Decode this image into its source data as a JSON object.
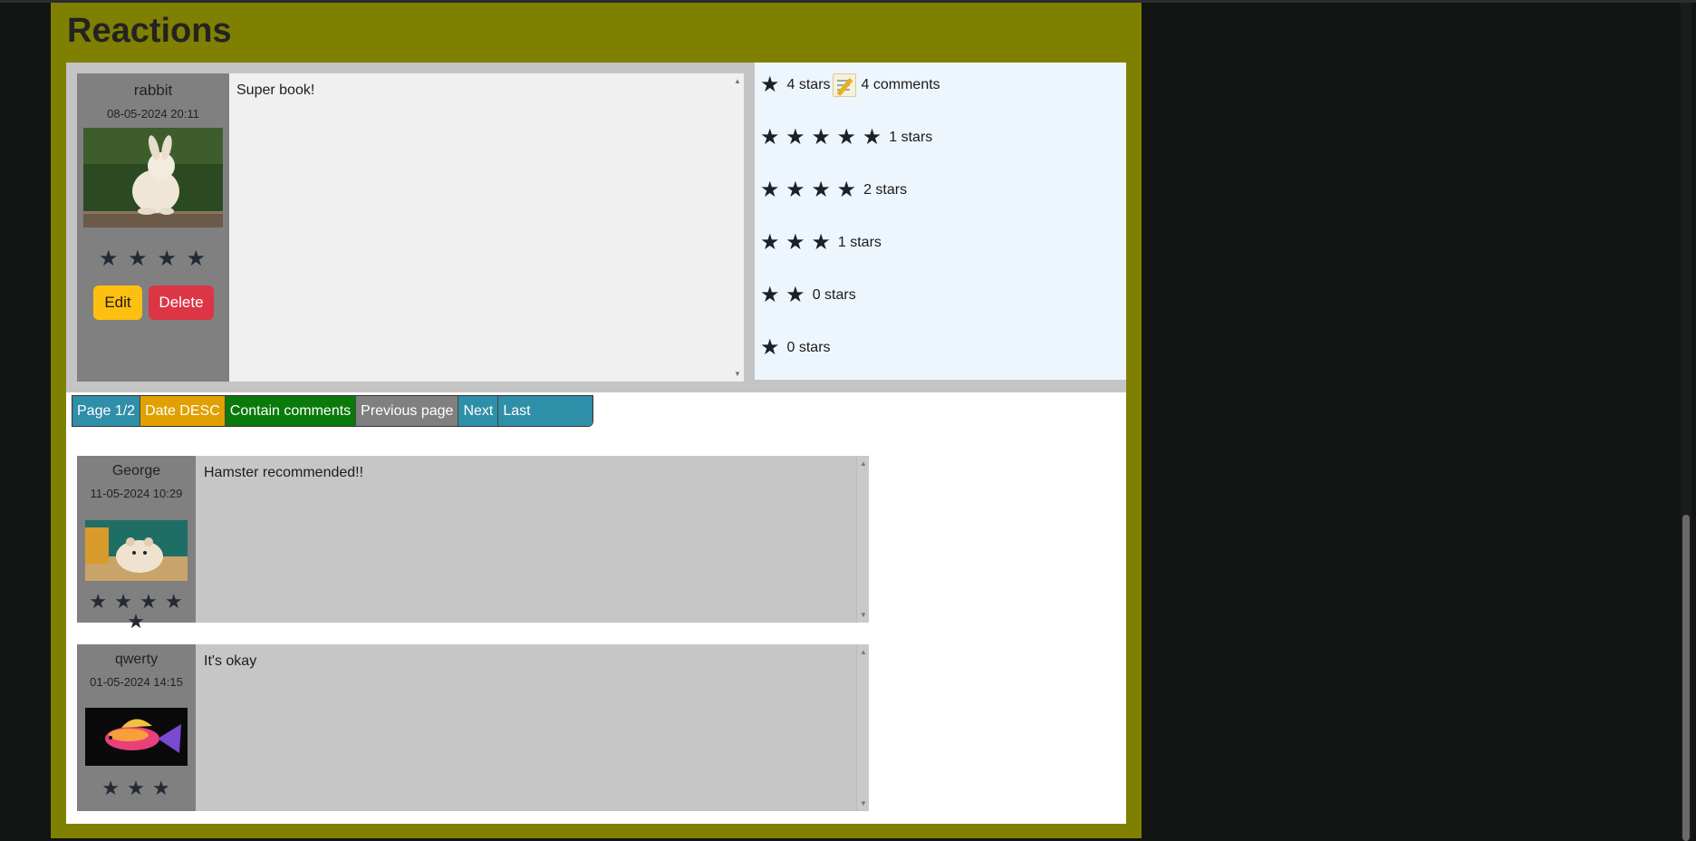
{
  "section_title": "Reactions",
  "own_reaction": {
    "user": "rabbit",
    "date": "08-05-2024 20:11",
    "stars": "★ ★ ★ ★",
    "avatar_icon": "rabbit-photo",
    "edit_label": "Edit",
    "delete_label": "Delete",
    "text": "Super book!"
  },
  "summary": {
    "overall_stars": "4 stars",
    "comments": "4 comments",
    "rows": [
      {
        "stars": "★ ★ ★ ★ ★",
        "label": "1 stars"
      },
      {
        "stars": "★ ★ ★ ★",
        "label": "2 stars"
      },
      {
        "stars": "★ ★ ★",
        "label": "1 stars"
      },
      {
        "stars": "★ ★",
        "label": "0 stars"
      },
      {
        "stars": "★",
        "label": "0 stars"
      }
    ]
  },
  "pager": {
    "page": "Page 1/2",
    "sort": "Date DESC",
    "filter": "Contain comments",
    "previous": "Previous page",
    "next": "Next",
    "last": "Last"
  },
  "comments": [
    {
      "user": "George",
      "date": "11-05-2024 10:29",
      "stars": "★ ★ ★ ★ ★",
      "avatar_icon": "hamster-photo",
      "text": "Hamster recommended!!"
    },
    {
      "user": "qwerty",
      "date": "01-05-2024 14:15",
      "stars": "★ ★ ★",
      "avatar_icon": "fish-photo",
      "text": "It's okay"
    }
  ],
  "colors": {
    "panel": "#808000",
    "page_badge": "#2f8ea8",
    "sort_badge": "#e0a000",
    "filter_badge": "#0a7a0a",
    "delete_button": "#dc3545",
    "edit_button": "#fdc010"
  }
}
